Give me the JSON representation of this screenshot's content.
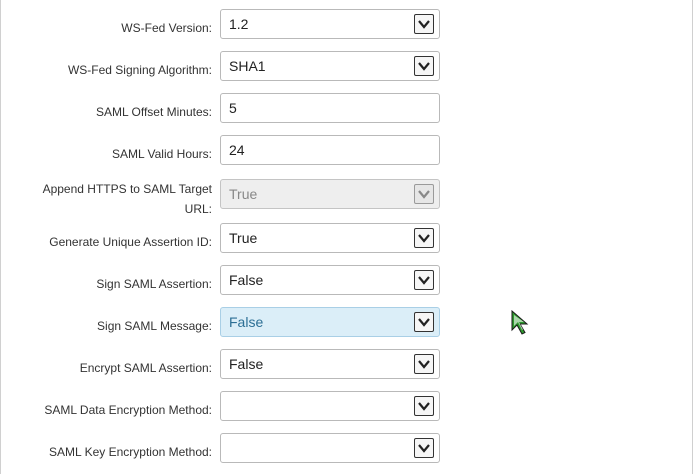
{
  "fields": [
    {
      "label": "WS-Fed Version:",
      "value": "1.2",
      "type": "select"
    },
    {
      "label": "WS-Fed Signing Algorithm:",
      "value": "SHA1",
      "type": "select"
    },
    {
      "label": "SAML Offset Minutes:",
      "value": "5",
      "type": "text"
    },
    {
      "label": "SAML Valid Hours:",
      "value": "24",
      "type": "text"
    },
    {
      "label_line1": "Append HTTPS to SAML Target",
      "label_line2": "URL:",
      "value": "True",
      "type": "select",
      "state": "disabled"
    },
    {
      "label": "Generate Unique Assertion ID:",
      "value": "True",
      "type": "select"
    },
    {
      "label": "Sign SAML Assertion:",
      "value": "False",
      "type": "select"
    },
    {
      "label": "Sign SAML Message:",
      "value": "False",
      "type": "select",
      "state": "focused"
    },
    {
      "label": "Encrypt SAML Assertion:",
      "value": "False",
      "type": "select"
    },
    {
      "label": "SAML Data Encryption Method:",
      "value": "",
      "type": "select"
    },
    {
      "label": "SAML Key Encryption Method:",
      "value": "",
      "type": "select"
    }
  ],
  "icons": {
    "dropdown": "chevron-down-icon",
    "cursor": "mouse-pointer-icon"
  },
  "colors": {
    "focused_bg": "#dbeef8",
    "disabled_bg": "#eeeeee",
    "cursor_green": "#2e9a2e"
  }
}
